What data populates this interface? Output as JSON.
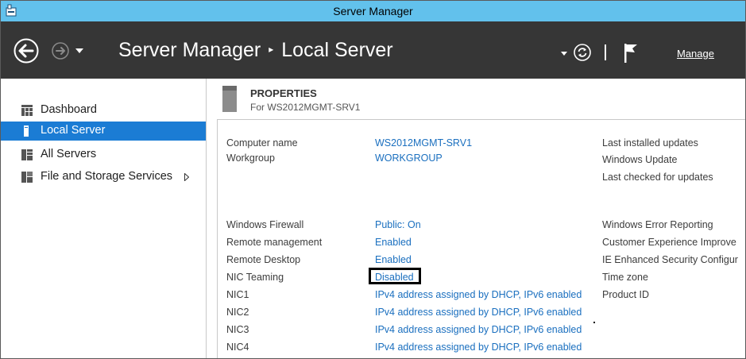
{
  "window": {
    "title": "Server Manager"
  },
  "header": {
    "breadcrumb_root": "Server Manager",
    "breadcrumb_separator": "▸",
    "breadcrumb_current": "Local Server",
    "manage_label": "Manage"
  },
  "sidebar": {
    "items": [
      {
        "label": "Dashboard",
        "icon": "dashboard-icon",
        "active": false
      },
      {
        "label": "Local Server",
        "icon": "local-server-icon",
        "active": true
      },
      {
        "label": "All Servers",
        "icon": "all-servers-icon",
        "active": false
      },
      {
        "label": "File and Storage Services",
        "icon": "file-storage-icon",
        "active": false,
        "has_submenu": true
      }
    ]
  },
  "properties": {
    "title": "PROPERTIES",
    "subtitle": "For WS2012MGMT-SRV1",
    "left_group_1": [
      {
        "label": "Computer name",
        "value": "WS2012MGMT-SRV1"
      },
      {
        "label": "Workgroup",
        "value": "WORKGROUP"
      }
    ],
    "left_group_2": [
      {
        "label": "Windows Firewall",
        "value": "Public: On"
      },
      {
        "label": "Remote management",
        "value": "Enabled"
      },
      {
        "label": "Remote Desktop",
        "value": "Enabled"
      },
      {
        "label": "NIC Teaming",
        "value": "Disabled"
      },
      {
        "label": "NIC1",
        "value": "IPv4 address assigned by DHCP, IPv6 enabled"
      },
      {
        "label": "NIC2",
        "value": "IPv4 address assigned by DHCP, IPv6 enabled"
      },
      {
        "label": "NIC3",
        "value": "IPv4 address assigned by DHCP, IPv6 enabled"
      },
      {
        "label": "NIC4",
        "value": "IPv4 address assigned by DHCP, IPv6 enabled"
      }
    ],
    "right_group_1": [
      "Last installed updates",
      "Windows Update",
      "Last checked for updates"
    ],
    "right_group_2": [
      "Windows Error Reporting",
      "Customer Experience Improve",
      "IE Enhanced Security Configur",
      "Time zone",
      "Product ID"
    ]
  },
  "colors": {
    "titlebar": "#62c1ec",
    "header": "#363636",
    "active_item": "#1b7cd4",
    "link": "#1a6fbf"
  }
}
